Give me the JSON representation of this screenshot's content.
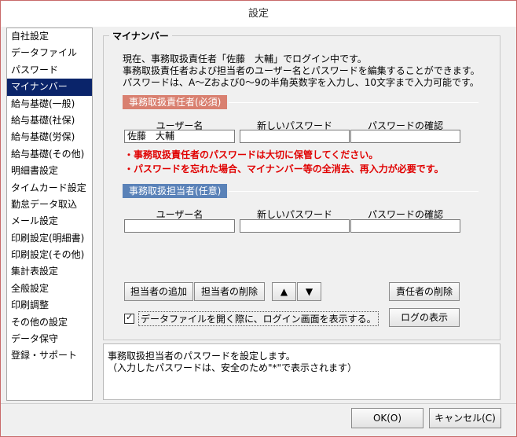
{
  "window": {
    "title": "設定"
  },
  "sidebar": {
    "items": [
      {
        "label": "自社設定"
      },
      {
        "label": "データファイル"
      },
      {
        "label": "パスワード"
      },
      {
        "label": "マイナンバー",
        "selected": true
      },
      {
        "label": "給与基礎(一般)"
      },
      {
        "label": "給与基礎(社保)"
      },
      {
        "label": "給与基礎(労保)"
      },
      {
        "label": "給与基礎(その他)"
      },
      {
        "label": "明細書設定"
      },
      {
        "label": "タイムカード設定"
      },
      {
        "label": "勤怠データ取込"
      },
      {
        "label": "メール設定"
      },
      {
        "label": "印刷設定(明細書)"
      },
      {
        "label": "印刷設定(その他)"
      },
      {
        "label": "集計表設定"
      },
      {
        "label": "全般設定"
      },
      {
        "label": "印刷調整"
      },
      {
        "label": "その他の設定"
      },
      {
        "label": "データ保守"
      },
      {
        "label": "登録・サポート"
      }
    ]
  },
  "main": {
    "group_title": "マイナンバー",
    "intro_lines": [
      "現在、事務取扱責任者「佐藤　大輔」でログイン中です。",
      "事務取扱責任者および担当者のユーザー名とパスワードを編集することができます。",
      "パスワードは、A～Zおよび0～9の半角英数字を入力し、10文字まで入力可能です。"
    ],
    "manager_section": {
      "label": "事務取扱責任者(必須)",
      "color": "#d98070",
      "col_user": "ユーザー名",
      "col_new_pw": "新しいパスワード",
      "col_confirm_pw": "パスワードの確認",
      "user_value": "佐藤　大輔",
      "new_pw_value": "",
      "confirm_pw_value": ""
    },
    "warnings": [
      "・事務取扱責任者のパスワードは大切に保管してください。",
      "・パスワードを忘れた場合、マイナンバー等の全消去、再入力が必要です。"
    ],
    "staff_section": {
      "label": "事務取扱担当者(任意)",
      "color": "#5a82b8",
      "col_user": "ユーザー名",
      "col_new_pw": "新しいパスワード",
      "col_confirm_pw": "パスワードの確認",
      "user_value": "",
      "new_pw_value": "",
      "confirm_pw_value": ""
    },
    "buttons": {
      "add_staff": "担当者の追加",
      "delete_staff": "担当者の削除",
      "up": "▲",
      "down": "▼",
      "delete_manager": "責任者の削除",
      "show_log": "ログの表示"
    },
    "checkbox": {
      "label": "データファイルを開く際に、ログイン画面を表示する。",
      "checked": true
    }
  },
  "description": {
    "lines": [
      "事務取扱担当者のパスワードを設定します。",
      "（入力したパスワードは、安全のため\"*\"で表示されます）"
    ]
  },
  "footer": {
    "ok_label": "OK(O)",
    "cancel_label": "キャンセル(C)"
  }
}
